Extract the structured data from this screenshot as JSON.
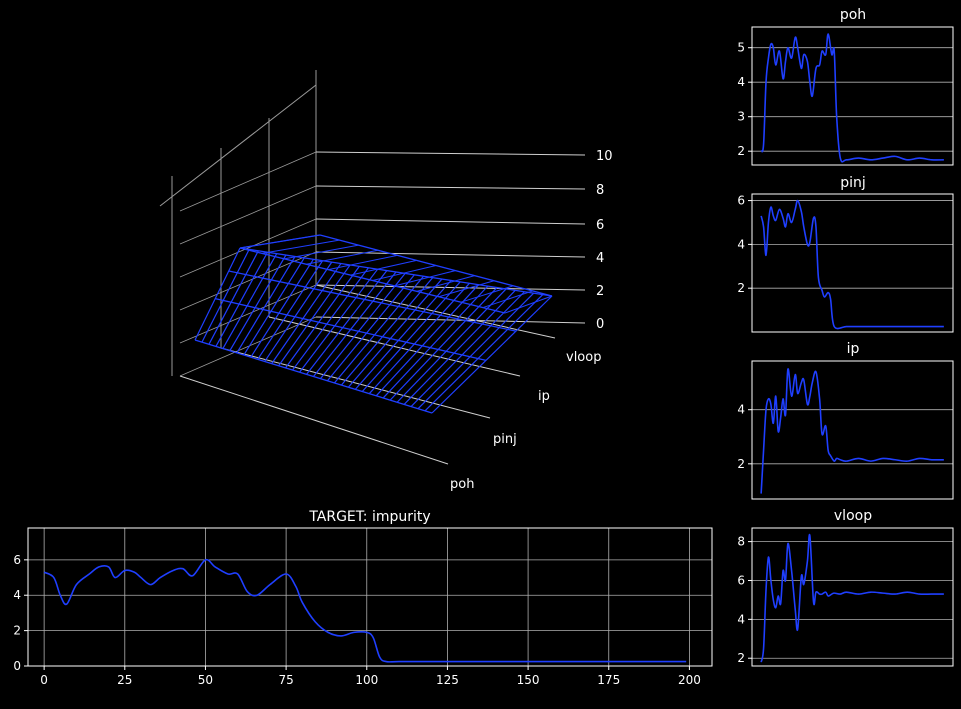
{
  "colors": {
    "background": "#000000",
    "line": "#1f3fff",
    "axis": "#ffffff",
    "grid": "#b0b0b0"
  },
  "chart_data": [
    {
      "type": "wireframe-3d",
      "title": "",
      "axes": {
        "depth_labels": [
          "poh",
          "pinj",
          "ip",
          "vloop"
        ],
        "z_ticks": [
          "0",
          "2",
          "4",
          "6",
          "8",
          "10"
        ]
      }
    },
    {
      "type": "line",
      "title": "TARGET: impurity",
      "xlim": [
        -5,
        207
      ],
      "ylim": [
        0,
        7.8
      ],
      "xticks": [
        "0",
        "25",
        "50",
        "75",
        "100",
        "125",
        "150",
        "175",
        "200"
      ],
      "yticks": [
        "0",
        "2",
        "4",
        "6"
      ],
      "grid": true,
      "series": [
        {
          "x": [
            0,
            3,
            5,
            7,
            10,
            14,
            17,
            20,
            22,
            25,
            28,
            30,
            33,
            36,
            40,
            43,
            46,
            50,
            53,
            57,
            60,
            63,
            66,
            70,
            75,
            78,
            80,
            84,
            88,
            92,
            96,
            100,
            102,
            104,
            106,
            110,
            120,
            140,
            160,
            180,
            199
          ],
          "values": [
            5.3,
            5.0,
            4.0,
            3.5,
            4.6,
            5.2,
            5.6,
            5.6,
            5.0,
            5.4,
            5.3,
            5.0,
            4.6,
            5.0,
            5.4,
            5.5,
            5.1,
            6.0,
            5.6,
            5.2,
            5.2,
            4.2,
            4.0,
            4.6,
            5.2,
            4.5,
            3.6,
            2.5,
            1.9,
            1.7,
            1.9,
            1.9,
            1.6,
            0.5,
            0.25,
            0.25,
            0.25,
            0.25,
            0.25,
            0.25,
            0.25
          ]
        }
      ]
    },
    {
      "type": "line",
      "title": "poh",
      "ylim": [
        1.6,
        5.6
      ],
      "yticks": [
        "2",
        "3",
        "4",
        "5"
      ],
      "grid": "y",
      "series": [
        {
          "x": [
            0,
            2,
            4,
            6,
            8,
            10,
            12,
            15,
            18,
            20,
            22,
            25,
            28,
            30,
            33,
            35,
            38,
            40,
            42,
            45,
            48,
            50,
            53,
            55,
            58,
            60,
            62,
            65,
            70,
            80,
            90,
            100,
            110,
            120,
            130,
            140,
            150
          ],
          "values": [
            2.0,
            2.2,
            4.0,
            4.7,
            5.1,
            5.0,
            4.5,
            4.9,
            4.1,
            4.6,
            5.0,
            4.7,
            5.3,
            5.0,
            4.4,
            4.8,
            4.6,
            4.0,
            3.6,
            4.4,
            4.5,
            4.9,
            4.8,
            5.4,
            4.8,
            4.9,
            3.0,
            1.8,
            1.75,
            1.8,
            1.75,
            1.8,
            1.85,
            1.75,
            1.8,
            1.75,
            1.75
          ]
        }
      ]
    },
    {
      "type": "line",
      "title": "pinj",
      "ylim": [
        0,
        6.3
      ],
      "yticks": [
        "2",
        "4",
        "6"
      ],
      "grid": "y",
      "series": [
        {
          "x": [
            0,
            2,
            4,
            6,
            8,
            10,
            12,
            15,
            18,
            20,
            22,
            25,
            28,
            30,
            33,
            35,
            38,
            40,
            43,
            45,
            47,
            50,
            52,
            55,
            57,
            60,
            70,
            80,
            90,
            100,
            110,
            120,
            130,
            140,
            150
          ],
          "values": [
            5.3,
            4.8,
            3.5,
            5.0,
            5.7,
            5.3,
            5.1,
            5.6,
            5.2,
            4.8,
            5.4,
            5.0,
            5.6,
            6.0,
            5.5,
            4.8,
            4.0,
            4.1,
            5.2,
            4.8,
            2.5,
            1.9,
            1.6,
            1.8,
            1.5,
            0.25,
            0.25,
            0.25,
            0.25,
            0.25,
            0.25,
            0.25,
            0.25,
            0.25,
            0.25
          ]
        }
      ]
    },
    {
      "type": "line",
      "title": "ip",
      "ylim": [
        0.7,
        5.8
      ],
      "yticks": [
        "2",
        "4"
      ],
      "grid": "y",
      "series": [
        {
          "x": [
            0,
            2,
            4,
            6,
            8,
            10,
            12,
            14,
            16,
            18,
            20,
            22,
            25,
            28,
            30,
            33,
            35,
            38,
            40,
            42,
            45,
            48,
            50,
            53,
            55,
            57,
            60,
            62,
            65,
            70,
            80,
            90,
            100,
            110,
            120,
            130,
            140,
            150
          ],
          "values": [
            0.9,
            2.5,
            4.0,
            4.4,
            4.2,
            3.5,
            4.5,
            3.2,
            3.7,
            4.4,
            3.8,
            5.5,
            4.5,
            5.3,
            4.6,
            5.0,
            5.1,
            4.2,
            4.5,
            5.0,
            5.4,
            4.4,
            3.1,
            3.4,
            2.5,
            2.3,
            2.1,
            2.2,
            2.15,
            2.1,
            2.2,
            2.1,
            2.2,
            2.15,
            2.1,
            2.2,
            2.15,
            2.15
          ]
        }
      ]
    },
    {
      "type": "line",
      "title": "vloop",
      "ylim": [
        1.6,
        8.7
      ],
      "yticks": [
        "2",
        "4",
        "6",
        "8"
      ],
      "grid": "y",
      "series": [
        {
          "x": [
            0,
            2,
            4,
            6,
            8,
            10,
            12,
            14,
            16,
            18,
            20,
            22,
            25,
            28,
            30,
            33,
            35,
            38,
            40,
            43,
            45,
            48,
            50,
            53,
            55,
            58,
            60,
            65,
            70,
            80,
            90,
            100,
            110,
            120,
            130,
            140,
            150
          ],
          "values": [
            1.8,
            2.5,
            5.5,
            7.2,
            6.0,
            5.0,
            4.6,
            5.2,
            4.8,
            6.5,
            6.0,
            7.9,
            6.5,
            4.5,
            3.5,
            6.2,
            5.8,
            7.0,
            8.3,
            4.9,
            5.4,
            5.3,
            5.3,
            5.4,
            5.2,
            5.3,
            5.35,
            5.3,
            5.4,
            5.3,
            5.4,
            5.35,
            5.3,
            5.4,
            5.3,
            5.3,
            5.3
          ]
        }
      ]
    }
  ]
}
